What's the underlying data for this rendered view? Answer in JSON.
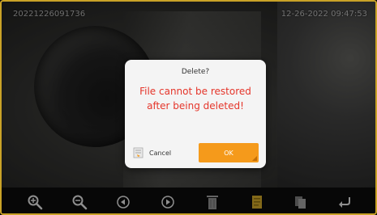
{
  "overlay": {
    "file_name": "20221226091736",
    "timestamp": "12-26-2022 09:47:53"
  },
  "dialog": {
    "title": "Delete?",
    "message": "File cannot be restored after being deleted!",
    "cancel_label": "Cancel",
    "ok_label": "OK"
  },
  "toolbar": {
    "items": [
      "zoom-in-icon",
      "zoom-out-icon",
      "previous-icon",
      "next-icon",
      "delete-icon",
      "file-icon",
      "copy-icon",
      "back-icon"
    ]
  },
  "colors": {
    "accent": "#f59a1b",
    "message_text": "#e5352a",
    "dialog_bg": "#f4f4f4",
    "frame": "#c9a227"
  }
}
